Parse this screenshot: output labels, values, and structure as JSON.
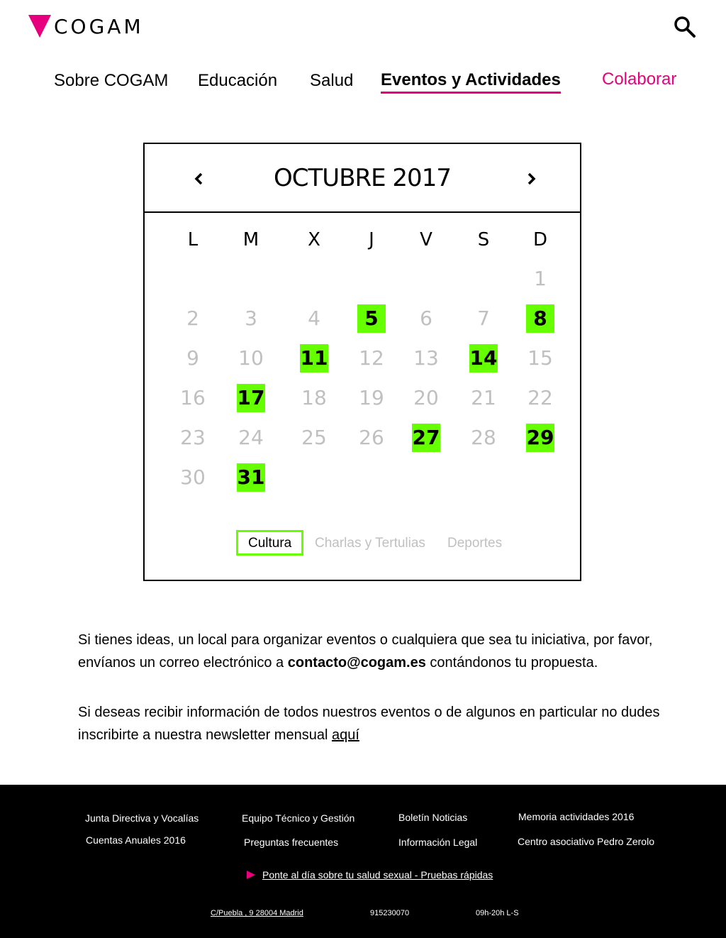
{
  "header": {
    "logo_text": "COGAM",
    "brand_color": "#e6007e",
    "search_icon": "search-icon"
  },
  "nav": {
    "items": [
      {
        "label": "Sobre COGAM"
      },
      {
        "label": "Educación"
      },
      {
        "label": "Salud"
      },
      {
        "label": "Eventos y Actividades",
        "active": true
      },
      {
        "label": "Colaborar"
      }
    ]
  },
  "calendar": {
    "month": "OCTUBRE 2017",
    "prev_icon": "chevron-left-icon",
    "next_icon": "chevron-right-icon",
    "weekdays": [
      "L",
      "M",
      "X",
      "J",
      "V",
      "S",
      "D"
    ],
    "days": [
      "1",
      "2",
      "3",
      "4",
      "5",
      "6",
      "7",
      "8",
      "9",
      "10",
      "11",
      "12",
      "13",
      "14",
      "15",
      "16",
      "17",
      "18",
      "19",
      "20",
      "21",
      "22",
      "23",
      "24",
      "25",
      "26",
      "27",
      "28",
      "29",
      "30",
      "31"
    ],
    "event_days": [
      5,
      8,
      11,
      14,
      17,
      27,
      29,
      31
    ],
    "event_color": "#66ff00",
    "filters": [
      "Cultura",
      "Charlas y Tertulias",
      "Deportes"
    ],
    "active_filter": "Cultura"
  },
  "content": {
    "p1_a": "Si tienes ideas, un local para organizar eventos o cualquiera que sea tu iniciativa, por favor, envíanos un correo electrónico a ",
    "p1_email": "contacto@cogam.es",
    "p1_b": " contándonos tu propuesta.",
    "p2_a": "Si deseas recibir información de todos nuestros eventos o de algunos en particular no dudes inscribirte a nuestra newsletter mensual ",
    "p2_link": "aquí"
  },
  "footer": {
    "links": [
      "Junta Directiva y Vocalías",
      "Equipo Técnico y Gestión",
      "Boletín Noticias",
      "Memoria actividades 2016",
      "Cuentas Anuales 2016",
      "Preguntas frecuentes",
      "Información Legal",
      "Centro asociativo Pedro Zerolo"
    ],
    "health_link": "Ponte al día sobre tu salud sexual - Pruebas rápidas",
    "address": "C/Puebla , 9 28004 Madrid",
    "phone": "915230070",
    "hours": "09h-20h L-S"
  }
}
